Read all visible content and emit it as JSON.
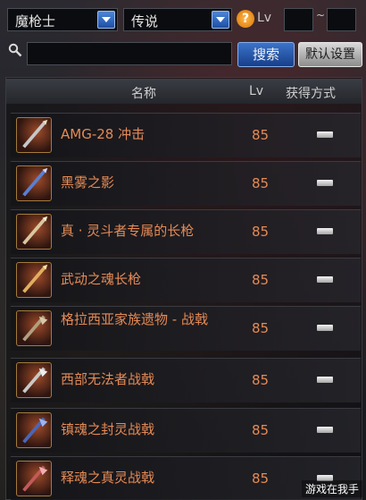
{
  "filters": {
    "class_value": "魔枪士",
    "rarity_value": "传说",
    "level_label": "Lv",
    "level_separator": "~",
    "level_min": "",
    "level_max": "",
    "help_symbol": "?"
  },
  "search": {
    "query": "",
    "search_button": "搜索",
    "reset_button": "默认设置"
  },
  "table": {
    "headers": {
      "name": "名称",
      "level": "Lv",
      "method": "获得方式"
    },
    "rows": [
      {
        "name": "AMG-28 冲击",
        "level": "85"
      },
      {
        "name": "黑雾之影",
        "level": "85"
      },
      {
        "name": "真 · 灵斗者专属的长枪",
        "level": "85"
      },
      {
        "name": "武动之魂长枪",
        "level": "85"
      },
      {
        "name": "格拉西亚家族遗物 - 战戟",
        "level": "85"
      },
      {
        "name": "西部无法者战戟",
        "level": "85"
      },
      {
        "name": "镇魂之封灵战戟",
        "level": "85"
      },
      {
        "name": "释魂之真灵战戟",
        "level": "85"
      }
    ]
  },
  "watermark": "游戏在我手",
  "colors": {
    "item_text": "#e58a55",
    "accent_button": "#2a5fb8"
  }
}
